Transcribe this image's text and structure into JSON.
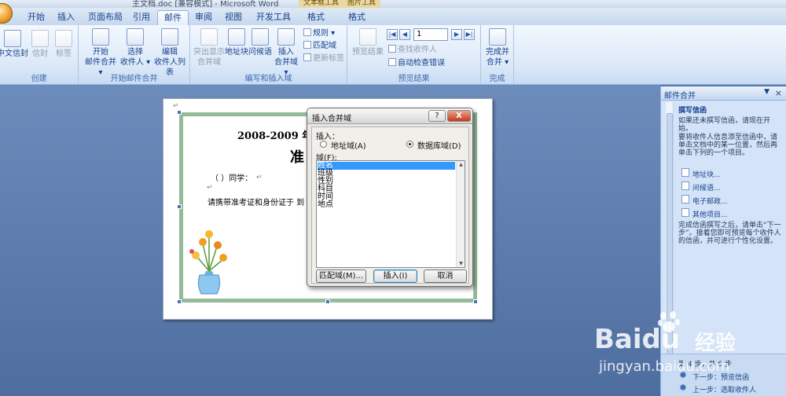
{
  "title_bar": {
    "title": "主文档.doc [兼容模式] - Microsoft Word",
    "contextual_tabs": [
      "文本框工具",
      "图片工具"
    ]
  },
  "ribbon_tabs": [
    "开始",
    "插入",
    "页面布局",
    "引用",
    "邮件",
    "审阅",
    "视图",
    "开发工具",
    "格式",
    "格式"
  ],
  "active_tab": "邮件",
  "groups": {
    "create": {
      "label": "创建",
      "buttons": [
        "中文信封",
        "信封",
        "标签"
      ]
    },
    "start_merge": {
      "label": "开始邮件合并",
      "buttons": [
        "开始\n邮件合并 ▾",
        "选择\n收件人 ▾",
        "编辑\n收件人列表"
      ]
    },
    "write_insert": {
      "label": "编写和插入域",
      "buttons": [
        "突出显示\n合并域",
        "地址块",
        "问候语",
        "插入\n合并域 ▾"
      ],
      "small": [
        "规则 ▾",
        "匹配域",
        "更新标签"
      ]
    },
    "preview": {
      "label": "预览结果",
      "preview_button": "预览结果",
      "record_value": "1",
      "small": [
        "查找收件人",
        "自动检查错误"
      ]
    },
    "finish": {
      "label": "完成",
      "button": "完成并\n合并 ▾"
    }
  },
  "document": {
    "title_line": "2008-2009 年度",
    "subtitle": "准",
    "line1": "（ ）同学：",
    "line2": "请携带准考证和身份证于  到"
  },
  "dialog": {
    "title": "插入合并域",
    "help_label": "?",
    "close_label": "X",
    "insert_label": "插入：",
    "radio_address": "地址域(A)",
    "radio_database": "数据库域(D)",
    "database_selected": true,
    "fields_label": "域(F):",
    "fields": [
      "姓名",
      "班级",
      "性别",
      "科目",
      "时间",
      "地点"
    ],
    "selected_field": "姓名",
    "match_button": "匹配域(M)...",
    "insert_button": "插入(I)",
    "cancel_button": "取消"
  },
  "task_pane": {
    "title": "邮件合并",
    "section": "撰写信函",
    "text1": "如果还未撰写信函，请现在开始。",
    "text2": "要将收件人信息添至信函中，请单击文档中的某一位置，然后再单击下列的一个项目。",
    "links": [
      "地址块...",
      "问候语...",
      "电子邮政...",
      "其他项目..."
    ],
    "text3": "完成信函撰写之后，请单击“下一步”。接着您即可预览每个收件人的信函，并可进行个性化设置。",
    "step": "第 4 步，共 6 步",
    "next": "下一步：预览信函",
    "prev": "上一步：选取收件人"
  },
  "watermark": {
    "brand": "Baidu",
    "brand_cn": "经验",
    "url": "jingyan.baidu.com"
  }
}
